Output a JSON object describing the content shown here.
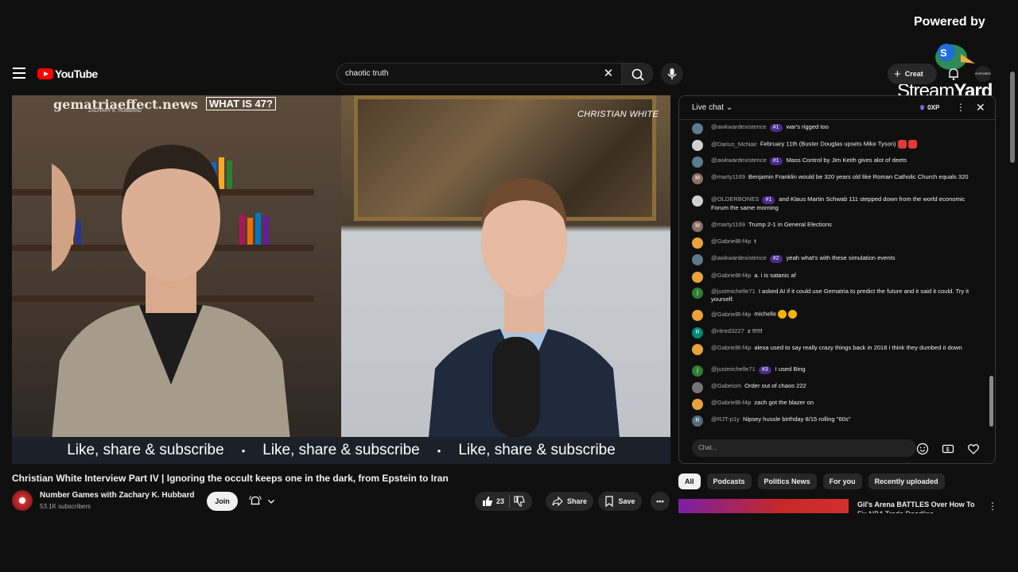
{
  "overlay": {
    "powered_by": "Powered by",
    "brand_stream": "Stream",
    "brand_yard": "Yard"
  },
  "header": {
    "logo_text": "YouTube",
    "search_value": "chaotic truth",
    "create_label": "Creat",
    "avatar_text": "EXPOSED"
  },
  "video": {
    "brand_top": "gematriaeffect.news",
    "brand_sub": "ZACHARY K. HUBBARD",
    "brand_tag": "WHAT IS 47?",
    "guest_name": "CHRISTIAN WHITE",
    "ticker": [
      "Like, share & subscribe",
      "Like, share & subscribe",
      "Like, share & subscribe"
    ],
    "ticker_sep": "•",
    "title": "Christian White Interview Part IV | Ignoring the occult keeps one in the dark, from Epstein to Iran"
  },
  "channel": {
    "name": "Number Games with Zachary K. Hubbard",
    "subscribers": "53.1K subscribers",
    "join_label": "Join"
  },
  "actions": {
    "like_count": "23",
    "share_label": "Share",
    "save_label": "Save"
  },
  "chat": {
    "header_label": "Live chat",
    "xp_label": "0XP",
    "input_placeholder": "Chat...",
    "messages": [
      {
        "author": "@awkwardexistence",
        "badge": "#1",
        "text": "war's rigged too",
        "color": "#5b7b8a"
      },
      {
        "author": "@Darius_McNair",
        "badge": "",
        "text": "February 11th (Buster Douglas upsets Mike Tyson)",
        "color": "#cfcfcf"
      },
      {
        "author": "@awkwardexistence",
        "badge": "#1",
        "text": "Mass Control by Jim Keith gives alot of deets",
        "color": "#5b7b8a"
      },
      {
        "author": "@marty1169",
        "badge": "",
        "text": "Benjamin Franklin would be 320 years old like Roman Catholic Church equals 320",
        "color": "#8d6e63",
        "initial": "M"
      },
      {
        "author": "@OLDERBONES",
        "badge": "#1",
        "text": "and Klaus Martin Schwab 111 stepped down from the world economic Forum the same morning",
        "color": "#cfcfcf"
      },
      {
        "author": "@marty1169",
        "badge": "",
        "text": "Trump 2-1 in General Elections",
        "color": "#8d6e63",
        "initial": "M"
      },
      {
        "author": "@GabrielB-f4p",
        "badge": "",
        "text": "t",
        "color": "#e9a23b"
      },
      {
        "author": "@awkwardexistence",
        "badge": "#2",
        "text": "yeah what's with these simulation events",
        "color": "#5b7b8a"
      },
      {
        "author": "@GabrielB-f4p",
        "badge": "",
        "text": "a. i is satanic af",
        "color": "#e9a23b"
      },
      {
        "author": "@justmichelle71",
        "badge": "",
        "text": "I asked AI if it could use Gematria to predict the future and it said it could. Try it yourself.",
        "color": "#2e7d32",
        "initial": "j"
      },
      {
        "author": "@GabrielB-f4p",
        "badge": "",
        "text": "michelle",
        "color": "#e9a23b"
      },
      {
        "author": "@ritred3227",
        "badge": "",
        "text": "z !!!!!!",
        "color": "#00897b",
        "initial": "R"
      },
      {
        "author": "@GabrielB-f4p",
        "badge": "",
        "text": "alexa used to say really crazy things back in 2018 i think they dumbed it down",
        "color": "#e9a23b"
      },
      {
        "author": "@justmichelle71",
        "badge": "#3",
        "text": "I used Bing",
        "color": "#2e7d32",
        "initial": "j"
      },
      {
        "author": "@Gabeism",
        "badge": "",
        "text": "Order out of chaos 222",
        "color": "#757575"
      },
      {
        "author": "@GabrielB-f4p",
        "badge": "",
        "text": "zach got the blazer on",
        "color": "#e9a23b"
      },
      {
        "author": "@RJT-p1y",
        "badge": "",
        "text": "Nipsey hussle birthday 8/15 rolling \"60s\"",
        "color": "#546e7a",
        "initial": "R"
      }
    ]
  },
  "chips": [
    "All",
    "Podcasts",
    "Politics News",
    "For you",
    "Recently uploaded"
  ],
  "recommendation": {
    "title": "Gil's Arena BATTLES Over How To",
    "title_line2": "Fix NBA Trade Deadline"
  },
  "colors": {
    "background": "#0f0f0f",
    "accent_red": "#ff0000",
    "badge_purple": "#4a2a8c"
  }
}
